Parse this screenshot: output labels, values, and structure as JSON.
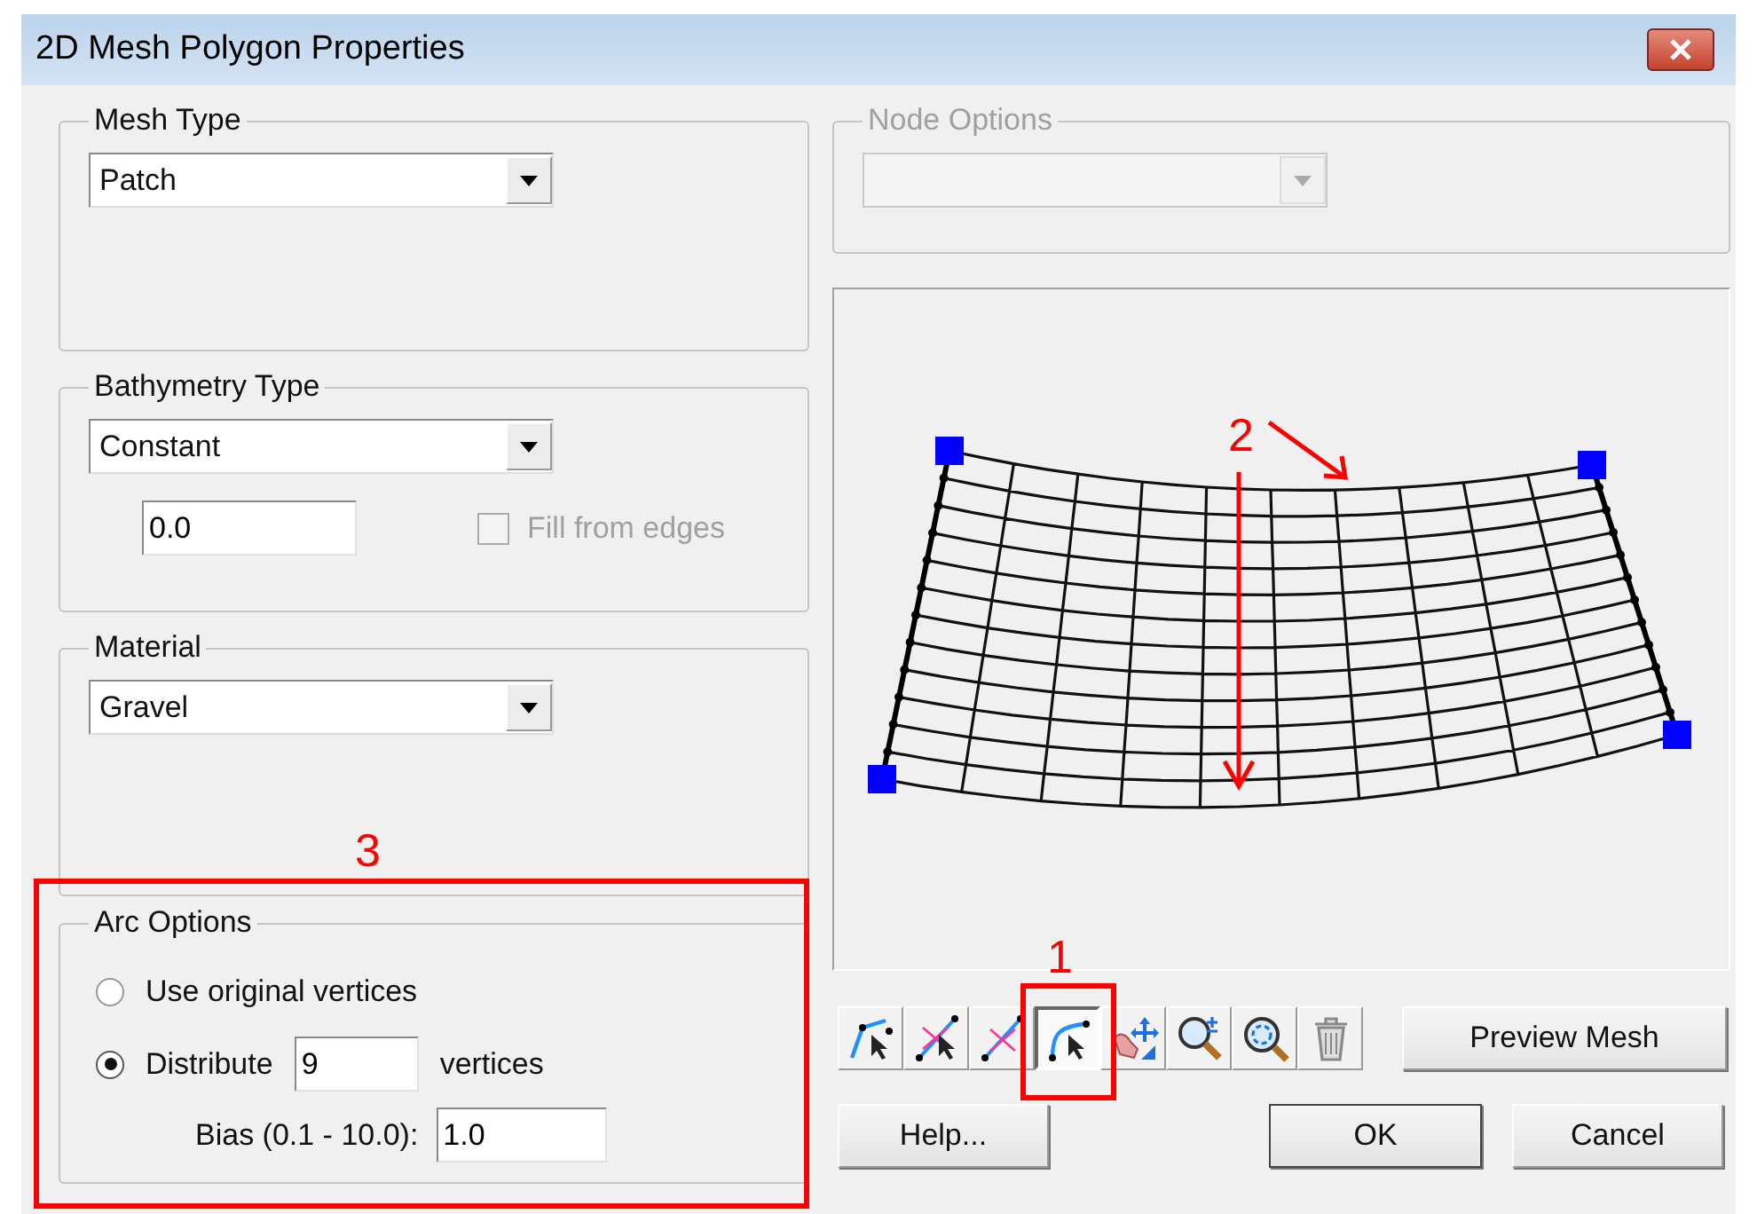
{
  "window": {
    "title": "2D Mesh Polygon Properties"
  },
  "mesh_type": {
    "label": "Mesh Type",
    "value": "Patch"
  },
  "bathymetry_type": {
    "label": "Bathymetry Type",
    "value": "Constant",
    "elevation": "0.0",
    "fill_from_edges": {
      "label": "Fill from edges",
      "checked": false,
      "disabled": true
    }
  },
  "material": {
    "label": "Material",
    "value": "Gravel"
  },
  "arc_options": {
    "label": "Arc Options",
    "options": [
      {
        "label": "Use original vertices",
        "selected": false
      },
      {
        "label": "Distribute",
        "selected": true,
        "value": "9",
        "suffix": "vertices"
      }
    ],
    "bias": {
      "label": "Bias (0.1 - 10.0):",
      "value": "1.0"
    }
  },
  "node_options": {
    "label": "Node Options",
    "disabled": true
  },
  "toolbar": [
    {
      "kind": "arc-select",
      "selected": false
    },
    {
      "kind": "split-select",
      "selected": false
    },
    {
      "kind": "split",
      "selected": false
    },
    {
      "kind": "curve-select",
      "selected": true
    },
    {
      "kind": "hand-move",
      "selected": false
    },
    {
      "kind": "zoom",
      "selected": false
    },
    {
      "kind": "zoom-extents",
      "selected": false
    },
    {
      "kind": "delete",
      "selected": false
    }
  ],
  "preview_button": "Preview Mesh",
  "buttons": [
    {
      "kind": "help",
      "label": "Help..."
    },
    {
      "kind": "ok",
      "label": "OK"
    },
    {
      "kind": "cancel",
      "label": "Cancel"
    }
  ],
  "annotations": [
    {
      "label": "1"
    },
    {
      "label": "2"
    },
    {
      "label": "3"
    }
  ]
}
